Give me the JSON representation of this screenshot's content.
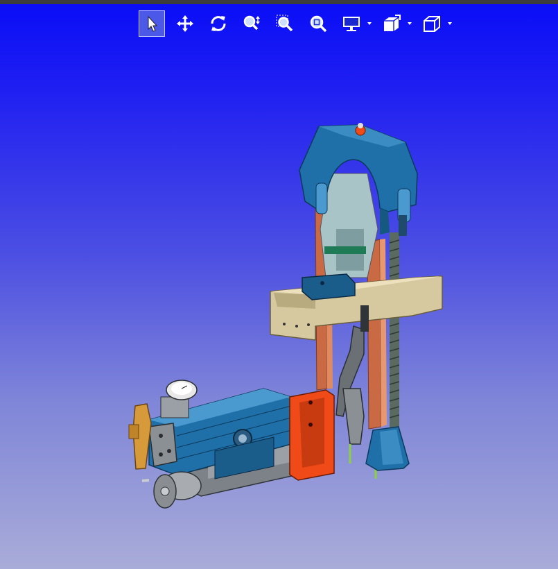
{
  "toolbar": {
    "buttons": [
      {
        "id": "select",
        "icon": "cursor-arrow-icon",
        "active": true
      },
      {
        "id": "pan",
        "icon": "move-arrows-icon",
        "active": false
      },
      {
        "id": "rotate",
        "icon": "rotate-icon",
        "active": false
      },
      {
        "id": "zoom",
        "icon": "zoom-in-out-icon",
        "active": false
      },
      {
        "id": "zoom-window",
        "icon": "zoom-window-icon",
        "active": false
      },
      {
        "id": "zoom-fit",
        "icon": "zoom-fit-icon",
        "active": false
      },
      {
        "id": "display-mode",
        "icon": "monitor-icon",
        "dropdown": true
      },
      {
        "id": "section",
        "icon": "section-cube-icon",
        "dropdown": true
      },
      {
        "id": "view-orientation",
        "icon": "cube-view-icon",
        "dropdown": true
      }
    ]
  },
  "colors": {
    "background_top": "#0a0ef6",
    "background_bottom": "#a9acd8",
    "toolbar_active": "#4b58e8",
    "model_blue": "#1f6fa8",
    "model_copper": "#c96a45",
    "model_beige": "#d6c9a0",
    "model_orange": "#ef4a17"
  }
}
